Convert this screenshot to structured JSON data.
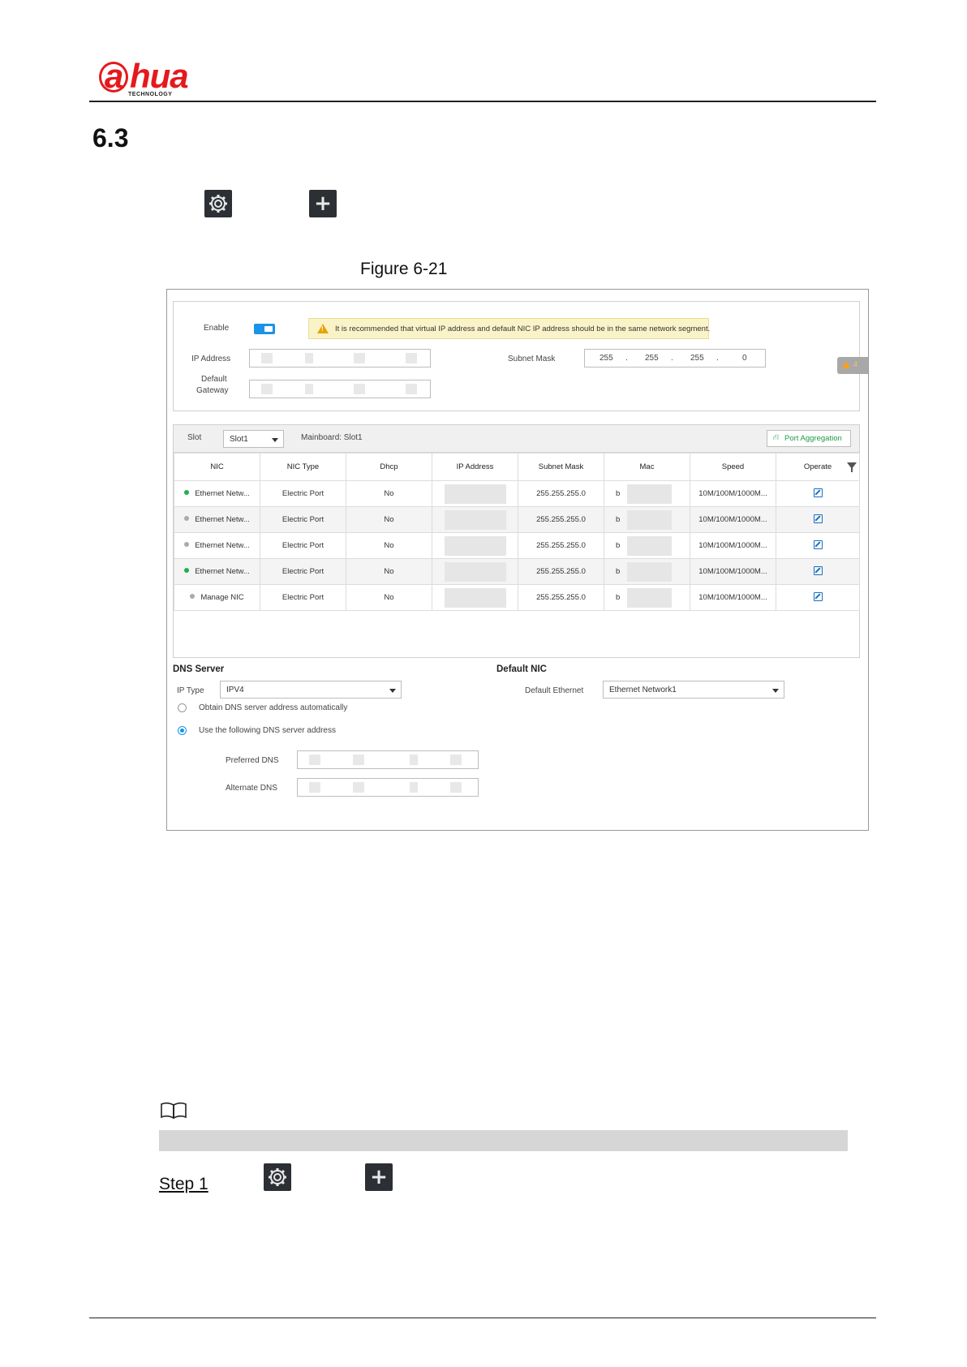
{
  "header": {
    "logo_text": "hua",
    "logo_prefix": "a",
    "logo_sub": "TECHNOLOGY"
  },
  "section": {
    "number": "6.3"
  },
  "figure": {
    "caption": "Figure 6-21"
  },
  "screenshot": {
    "enable_label": "Enable",
    "enable_on": true,
    "warning": "It is recommended that virtual IP address and default NIC IP address should be in the same network segment.",
    "ip_label": "IP Address",
    "mask_label": "Subnet Mask",
    "mask": [
      "255",
      ".",
      "255",
      ".",
      "255",
      ".",
      "0"
    ],
    "gateway_label_1": "Default",
    "gateway_label_2": "Gateway",
    "side_badge": "4",
    "slot_label": "Slot",
    "slot_value": "Slot1",
    "mainboard": "Mainboard: Slot1",
    "port_aggregation": "Port Aggregation",
    "columns": [
      "NIC",
      "NIC Type",
      "Dhcp",
      "IP Address",
      "Subnet Mask",
      "Mac",
      "Speed",
      "Operate"
    ],
    "rows": [
      {
        "status": "on",
        "nic": "Ethernet Netw...",
        "type": "Electric Port",
        "dhcp": "No",
        "mask": "255.255.255.0",
        "mac": "b",
        "speed": "10M/100M/1000M..."
      },
      {
        "status": "off",
        "nic": "Ethernet Netw...",
        "type": "Electric Port",
        "dhcp": "No",
        "mask": "255.255.255.0",
        "mac": "b",
        "speed": "10M/100M/1000M..."
      },
      {
        "status": "off",
        "nic": "Ethernet Netw...",
        "type": "Electric Port",
        "dhcp": "No",
        "mask": "255.255.255.0",
        "mac": "b",
        "speed": "10M/100M/1000M..."
      },
      {
        "status": "on",
        "nic": "Ethernet Netw...",
        "type": "Electric Port",
        "dhcp": "No",
        "mask": "255.255.255.0",
        "mac": "b",
        "speed": "10M/100M/1000M..."
      },
      {
        "status": "off",
        "nic": "Manage NIC",
        "type": "Electric Port",
        "dhcp": "No",
        "mask": "255.255.255.0",
        "mac": "b",
        "speed": "10M/100M/1000M..."
      }
    ],
    "dns_title": "DNS Server",
    "ip_type_label": "IP Type",
    "ip_type_value": "IPV4",
    "radio_auto": "Obtain DNS server address automatically",
    "radio_manual": "Use the following DNS server address",
    "radio_selected": "manual",
    "preferred_dns": "Preferred DNS",
    "alternate_dns": "Alternate DNS",
    "default_nic_title": "Default NIC",
    "default_eth_label": "Default Ethernet",
    "default_eth_value": "Ethernet Network1"
  },
  "step": {
    "label": "Step 1"
  },
  "icons": [
    "gear-icon",
    "plus-icon",
    "book-icon"
  ],
  "colors": {
    "brand_red": "#e5191c",
    "accent_blue": "#1a93e8",
    "status_green": "#1fb04c",
    "link_green": "#1e9a47"
  }
}
